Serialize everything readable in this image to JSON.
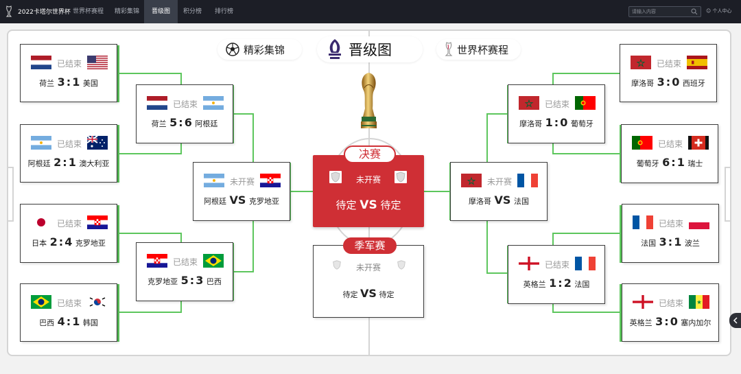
{
  "nav": {
    "site_title": "2022卡塔尔世界杯",
    "items": [
      "世界杯赛程",
      "精彩集锦",
      "晋级图",
      "积分榜",
      "排行榜"
    ],
    "active": "晋级图",
    "search_placeholder": "请输入内容",
    "user_center": "个人中心"
  },
  "header": {
    "highlights": "精彩集锦",
    "title": "晋级图",
    "schedule": "世界杯赛程"
  },
  "left": {
    "r16": [
      {
        "status": "已结束",
        "team1": "荷兰",
        "flag1": "netherlands",
        "score1": "3",
        "score2": "1",
        "team2": "美国",
        "flag2": "usa"
      },
      {
        "status": "已结束",
        "team1": "阿根廷",
        "flag1": "argentina",
        "score1": "2",
        "score2": "1",
        "team2": "澳大利亚",
        "flag2": "australia"
      },
      {
        "status": "已结束",
        "team1": "日本",
        "flag1": "japan",
        "score1": "2",
        "score2": "4",
        "team2": "克罗地亚",
        "flag2": "croatia"
      },
      {
        "status": "已结束",
        "team1": "巴西",
        "flag1": "brazil",
        "score1": "4",
        "score2": "1",
        "team2": "韩国",
        "flag2": "korea"
      }
    ],
    "qf": [
      {
        "status": "已结束",
        "team1": "荷兰",
        "flag1": "netherlands",
        "score1": "5",
        "score2": "6",
        "team2": "阿根廷",
        "flag2": "argentina"
      },
      {
        "status": "已结束",
        "team1": "克罗地亚",
        "flag1": "croatia",
        "score1": "5",
        "score2": "3",
        "team2": "巴西",
        "flag2": "brazil"
      }
    ],
    "sf": {
      "status": "未开赛",
      "team1": "阿根廷",
      "flag1": "argentina",
      "vs": "VS",
      "team2": "克罗地亚",
      "flag2": "croatia"
    }
  },
  "right": {
    "r16": [
      {
        "status": "已结束",
        "team1": "摩洛哥",
        "flag1": "morocco",
        "score1": "3",
        "score2": "0",
        "team2": "西班牙",
        "flag2": "spain"
      },
      {
        "status": "已结束",
        "team1": "葡萄牙",
        "flag1": "portugal",
        "score1": "6",
        "score2": "1",
        "team2": "瑞士",
        "flag2": "switzerland"
      },
      {
        "status": "已结束",
        "team1": "法国",
        "flag1": "france",
        "score1": "3",
        "score2": "1",
        "team2": "波兰",
        "flag2": "poland"
      },
      {
        "status": "已结束",
        "team1": "英格兰",
        "flag1": "england",
        "score1": "3",
        "score2": "0",
        "team2": "塞内加尔",
        "flag2": "senegal"
      }
    ],
    "qf": [
      {
        "status": "已结束",
        "team1": "摩洛哥",
        "flag1": "morocco",
        "score1": "1",
        "score2": "0",
        "team2": "葡萄牙",
        "flag2": "portugal"
      },
      {
        "status": "已结束",
        "team1": "英格兰",
        "flag1": "england",
        "score1": "1",
        "score2": "2",
        "team2": "法国",
        "flag2": "france"
      }
    ],
    "sf": {
      "status": "未开赛",
      "team1": "摩洛哥",
      "flag1": "morocco",
      "vs": "VS",
      "team2": "法国",
      "flag2": "france"
    }
  },
  "final": {
    "tag": "决赛",
    "status": "未开赛",
    "team1": "待定",
    "vs": "VS",
    "team2": "待定"
  },
  "third_place": {
    "tag": "季军赛",
    "status": "未开赛",
    "team1": "待定",
    "vs": "VS",
    "team2": "待定"
  },
  "colors": {
    "accent": "#cf2f35",
    "connector": "#5cc65c",
    "topbar": "#1c1e26"
  }
}
